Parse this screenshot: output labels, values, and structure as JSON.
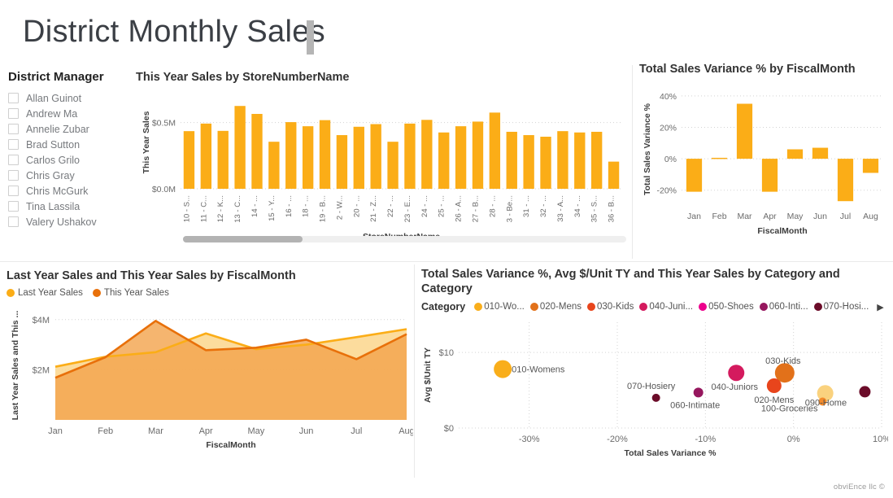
{
  "report": {
    "title": "District Monthly Sales",
    "watermark": "obviEnce llc ©"
  },
  "colors": {
    "bar_amber": "#FBAD17",
    "line_last_year": "#FBAD17",
    "line_this_year": "#E8700A",
    "area_fill_last_year": "#FBD68C",
    "area_fill_this_year": "#F2A34B",
    "title_text": "#3b3f45",
    "grid": "#d8d8d8",
    "cat_010": "#F9AE1B",
    "cat_020": "#E2711A",
    "cat_030": "#E8451C",
    "cat_040": "#D41A5E",
    "cat_050": "#EC008C",
    "cat_060": "#96175E",
    "cat_070": "#6B0C29",
    "cat_090": "#FAD27E",
    "cat_100": "#F48B2A"
  },
  "slicer": {
    "header": "District Manager",
    "items": [
      {
        "label": "Allan Guinot",
        "checked": false
      },
      {
        "label": "Andrew Ma",
        "checked": false
      },
      {
        "label": "Annelie Zubar",
        "checked": false
      },
      {
        "label": "Brad Sutton",
        "checked": false
      },
      {
        "label": "Carlos Grilo",
        "checked": false
      },
      {
        "label": "Chris Gray",
        "checked": false
      },
      {
        "label": "Chris McGurk",
        "checked": false
      },
      {
        "label": "Tina Lassila",
        "checked": false
      },
      {
        "label": "Valery Ushakov",
        "checked": false
      }
    ]
  },
  "chart_data": [
    {
      "id": "this_year_sales_by_store",
      "type": "bar",
      "title": "This Year Sales by StoreNumberName",
      "xlabel": "StoreNumberName",
      "ylabel": "This Year Sales",
      "ylim": [
        0,
        0.7
      ],
      "ytick_labels": [
        "$0.0M",
        "$0.5M"
      ],
      "ytick_values": [
        0,
        0.5
      ],
      "grid": true,
      "categories": [
        "10 - S...",
        "11 - C...",
        "12 - K...",
        "13 - C...",
        "14 - ...",
        "15 - Y...",
        "16 - ...",
        "18 - ...",
        "19 - B...",
        "2 - W...",
        "20 - ...",
        "21 - Z...",
        "22 - ...",
        "23 - E...",
        "24 - ...",
        "25 - ...",
        "26 - A...",
        "27 - B...",
        "28 - ...",
        "3 - Be...",
        "31 - ...",
        "32 - ...",
        "33 - A...",
        "34 - ...",
        "35 - S...",
        "36 - B..."
      ],
      "values": [
        0.435,
        0.492,
        0.437,
        0.625,
        0.565,
        0.355,
        0.503,
        0.472,
        0.518,
        0.405,
        0.468,
        0.488,
        0.355,
        0.492,
        0.52,
        0.425,
        0.472,
        0.507,
        0.575,
        0.43,
        0.405,
        0.393,
        0.435,
        0.425,
        0.43,
        0.205
      ],
      "scroll_position": 0.0,
      "scroll_thumb_fraction": 0.27
    },
    {
      "id": "total_sales_variance_by_fiscalmonth",
      "type": "bar",
      "title": "Total Sales Variance % by FiscalMonth",
      "xlabel": "FiscalMonth",
      "ylabel": "Total Sales Variance %",
      "ylim": [
        -30,
        42
      ],
      "ytick_labels": [
        "-20%",
        "0%",
        "20%",
        "40%"
      ],
      "ytick_values": [
        -20,
        0,
        20,
        40
      ],
      "grid": true,
      "categories": [
        "Jan",
        "Feb",
        "Mar",
        "Apr",
        "May",
        "Jun",
        "Jul",
        "Aug"
      ],
      "values": [
        -21.0,
        0.6,
        35.0,
        -21.0,
        6.0,
        7.0,
        -27.0,
        -9.0
      ]
    },
    {
      "id": "last_year_and_this_year_sales_by_fiscalmonth",
      "type": "area",
      "title": "Last Year Sales and This Year Sales by FiscalMonth",
      "xlabel": "FiscalMonth",
      "ylabel": "Last Year Sales and This ...",
      "ylim": [
        0,
        4.35
      ],
      "ytick_labels": [
        "$2M",
        "$4M"
      ],
      "ytick_values": [
        2,
        4
      ],
      "grid": true,
      "legend_position": "top-left",
      "categories": [
        "Jan",
        "Feb",
        "Mar",
        "Apr",
        "May",
        "Jun",
        "Jul",
        "Aug"
      ],
      "series": [
        {
          "name": "Last Year Sales",
          "color": "#FBAD17",
          "values": [
            2.12,
            2.52,
            2.7,
            3.45,
            2.82,
            3.0,
            3.3,
            3.62
          ]
        },
        {
          "name": "This Year Sales",
          "color": "#E8700A",
          "values": [
            1.68,
            2.5,
            3.95,
            2.78,
            2.88,
            3.2,
            2.42,
            3.42
          ]
        }
      ]
    },
    {
      "id": "variance_unitprice_sales_by_category",
      "type": "scatter",
      "title": "Total Sales Variance %, Avg $/Unit TY and This Year Sales by Category and Category",
      "xlabel": "Total Sales Variance %",
      "ylabel": "Avg $/Unit TY",
      "xlim": [
        -38,
        10
      ],
      "ylim": [
        0,
        14
      ],
      "xtick_labels": [
        "-30%",
        "-20%",
        "-10%",
        "0%",
        "10%"
      ],
      "xtick_values": [
        -30,
        -20,
        -10,
        0,
        10
      ],
      "ytick_labels": [
        "$0",
        "$10"
      ],
      "ytick_values": [
        0,
        10
      ],
      "grid": true,
      "legend_title": "Category",
      "legend_entries": [
        {
          "label": "010-Wo...",
          "color": "#F9AE1B"
        },
        {
          "label": "020-Mens",
          "color": "#E2711A"
        },
        {
          "label": "030-Kids",
          "color": "#E8451C"
        },
        {
          "label": "040-Juni...",
          "color": "#D41A5E"
        },
        {
          "label": "050-Shoes",
          "color": "#EC008C"
        },
        {
          "label": "060-Inti...",
          "color": "#96175E"
        },
        {
          "label": "070-Hosi...",
          "color": "#6B0C29"
        }
      ],
      "legend_more": "▶",
      "points": [
        {
          "label": "010-Womens",
          "x": -33.0,
          "y": 7.8,
          "size": 11,
          "color": "#F9AE1B",
          "label_dx": 11,
          "label_dy": 4
        },
        {
          "label": "070-Hosiery",
          "x": -15.6,
          "y": 4.0,
          "size": 5,
          "color": "#6B0C29",
          "label_dx": -6,
          "label_dy": -11
        },
        {
          "label": "060-Intimate",
          "x": -10.8,
          "y": 4.7,
          "size": 6,
          "color": "#96175E",
          "label_dx": -4,
          "label_dy": 19
        },
        {
          "label": "040-Juniors",
          "x": -6.5,
          "y": 7.3,
          "size": 10,
          "color": "#D41A5E",
          "label_dx": -2,
          "label_dy": 21
        },
        {
          "label": "030-Kids",
          "x": -1.0,
          "y": 7.3,
          "size": 12,
          "color": "#E2711A",
          "label_dx": -2,
          "label_dy": -11
        },
        {
          "label": "020-Mens",
          "x": -2.2,
          "y": 5.6,
          "size": 9,
          "color": "#E8451C",
          "label_dx": 0,
          "label_dy": 21
        },
        {
          "label": "100-Groceries",
          "x": 3.6,
          "y": 4.6,
          "size": 10,
          "color": "#FAD27E",
          "label_dx": -44,
          "label_dy": 22
        },
        {
          "label": "090-Home",
          "x": 3.3,
          "y": 3.5,
          "size": 5,
          "color": "#F48B2A",
          "label_dx": 4,
          "label_dy": 5
        },
        {
          "label": "",
          "x": 8.1,
          "y": 4.8,
          "size": 7,
          "color": "#6B0C29",
          "label_dx": 0,
          "label_dy": 0
        }
      ]
    }
  ]
}
